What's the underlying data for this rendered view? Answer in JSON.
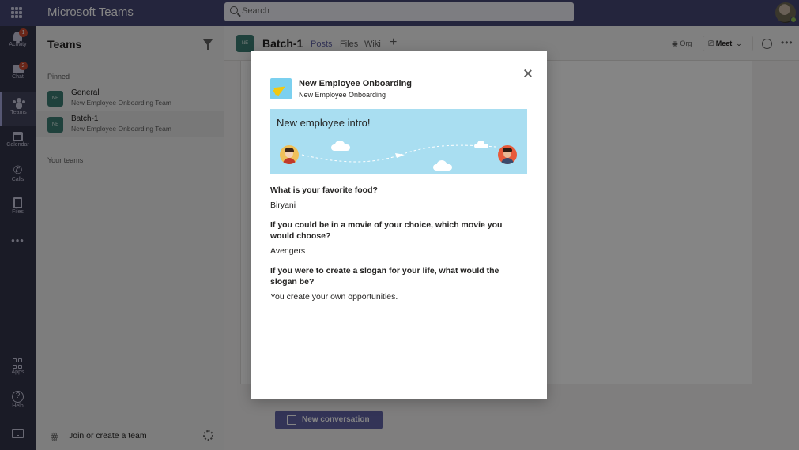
{
  "app": {
    "title": "Microsoft Teams"
  },
  "search": {
    "placeholder": "Search"
  },
  "appbar": {
    "items": [
      {
        "label": "Activity",
        "icon": "bell-icon",
        "badge": "1"
      },
      {
        "label": "Chat",
        "icon": "chat-icon",
        "badge": "2"
      },
      {
        "label": "Teams",
        "icon": "teams-icon"
      },
      {
        "label": "Calendar",
        "icon": "calendar-icon"
      },
      {
        "label": "Calls",
        "icon": "phone-icon"
      },
      {
        "label": "Files",
        "icon": "file-icon"
      },
      {
        "label": "Apps",
        "icon": "apps-icon"
      },
      {
        "label": "Help",
        "icon": "help-icon"
      }
    ]
  },
  "teams_panel": {
    "title": "Teams",
    "pinned_label": "Pinned",
    "your_teams_label": "Your teams",
    "teams": [
      {
        "avatar": "NE",
        "name": "General",
        "subtitle": "New Employee Onboarding Team"
      },
      {
        "avatar": "NE",
        "name": "Batch-1",
        "subtitle": "New Employee Onboarding Team"
      }
    ],
    "join_label": "Join or create a team"
  },
  "channel": {
    "avatar": "NE",
    "name": "Batch-1",
    "tabs": [
      "Posts",
      "Files",
      "Wiki"
    ],
    "org_label": "Org",
    "meet_label": "Meet",
    "new_conversation_label": "New conversation"
  },
  "dialog": {
    "title": "New Employee Onboarding",
    "subtitle": "New Employee Onboarding",
    "banner_text": "New employee intro!",
    "qa": [
      {
        "question": "What is your favorite food?",
        "answer": "Biryani"
      },
      {
        "question": "If you could be in a movie of your choice, which movie you would choose?",
        "answer": "Avengers"
      },
      {
        "question": "If you were to create a slogan for your life, what would the slogan be?",
        "answer": "You create your own opportunities."
      }
    ]
  },
  "colors": {
    "brand": "#464775",
    "accent": "#6264a7",
    "team_avatar": "#3d7d73",
    "banner": "#a9def1"
  }
}
